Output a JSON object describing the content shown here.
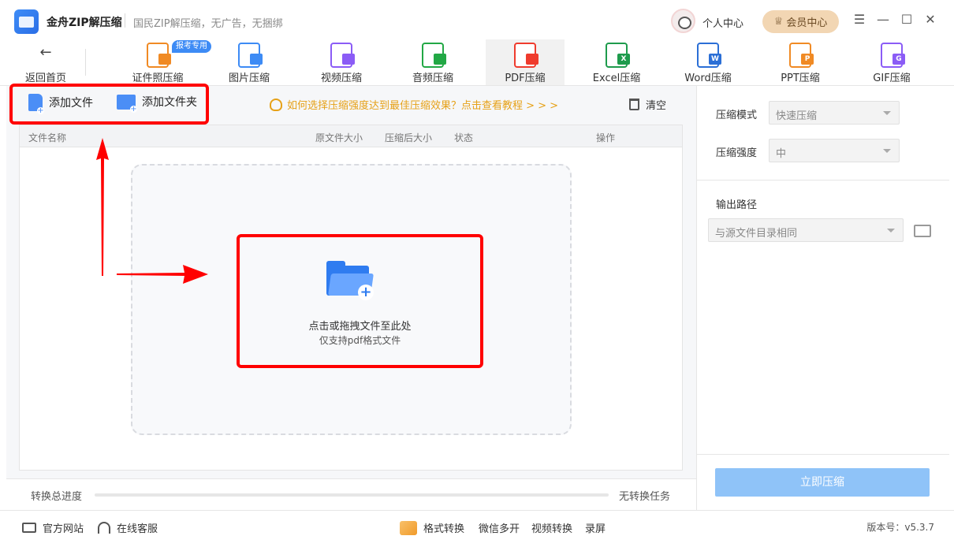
{
  "titlebar": {
    "app_title": "金舟ZIP解压缩",
    "slogan": "国民ZIP解压缩，无广告，无捆绑",
    "personal_center": "个人中心",
    "vip_center": "会员中心"
  },
  "toolbar": {
    "back_label": "返回首页",
    "badge": "报考专用",
    "tools": [
      {
        "label": "证件照压缩",
        "color": "#f08a24",
        "glyph": "",
        "icon": "id-photo-icon"
      },
      {
        "label": "图片压缩",
        "color": "#3d8bf5",
        "glyph": "",
        "icon": "image-icon"
      },
      {
        "label": "视频压缩",
        "color": "#8b5cf6",
        "glyph": "",
        "icon": "video-icon"
      },
      {
        "label": "音频压缩",
        "color": "#22a845",
        "glyph": "",
        "icon": "audio-icon"
      },
      {
        "label": "PDF压缩",
        "color": "#ef3b2d",
        "glyph": "",
        "icon": "pdf-icon"
      },
      {
        "label": "Excel压缩",
        "color": "#1e9b4c",
        "glyph": "X",
        "icon": "excel-icon"
      },
      {
        "label": "Word压缩",
        "color": "#2b6fd6",
        "glyph": "W",
        "icon": "word-icon"
      },
      {
        "label": "PPT压缩",
        "color": "#f08a24",
        "glyph": "P",
        "icon": "ppt-icon"
      },
      {
        "label": "GIF压缩",
        "color": "#8b5cf6",
        "glyph": "G",
        "icon": "gif-icon"
      }
    ],
    "active_index": 4
  },
  "actions": {
    "add_file": "添加文件",
    "add_folder": "添加文件夹",
    "tip": "如何选择压缩强度达到最佳压缩效果？点击查看教程 > > >",
    "clear": "清空"
  },
  "table": {
    "headers": {
      "name": "文件名称",
      "original_size": "原文件大小",
      "compressed_size": "压缩后大小",
      "status": "状态",
      "operation": "操作"
    }
  },
  "dropzone": {
    "main_text": "点击或拖拽文件至此处",
    "sub_text": "仅支持pdf格式文件"
  },
  "progress": {
    "label": "转换总进度",
    "value": 0,
    "status": "无转换任务"
  },
  "settings": {
    "mode_label": "压缩模式",
    "mode_value": "快速压缩",
    "strength_label": "压缩强度",
    "strength_value": "中",
    "output_label": "输出路径",
    "output_value": "与源文件目录相同",
    "start_button": "立即压缩"
  },
  "footer": {
    "website": "官方网站",
    "service": "在线客服",
    "format_convert": "格式转换",
    "wechat_multi": "微信多开",
    "video_convert": "视频转换",
    "screen_record": "录屏",
    "version": "版本号：v5.3.7"
  },
  "colors": {
    "accent": "#3d8bf5",
    "highlight_red": "#ff0000",
    "tip": "#e6a118",
    "vip": "#f2d6b3"
  }
}
